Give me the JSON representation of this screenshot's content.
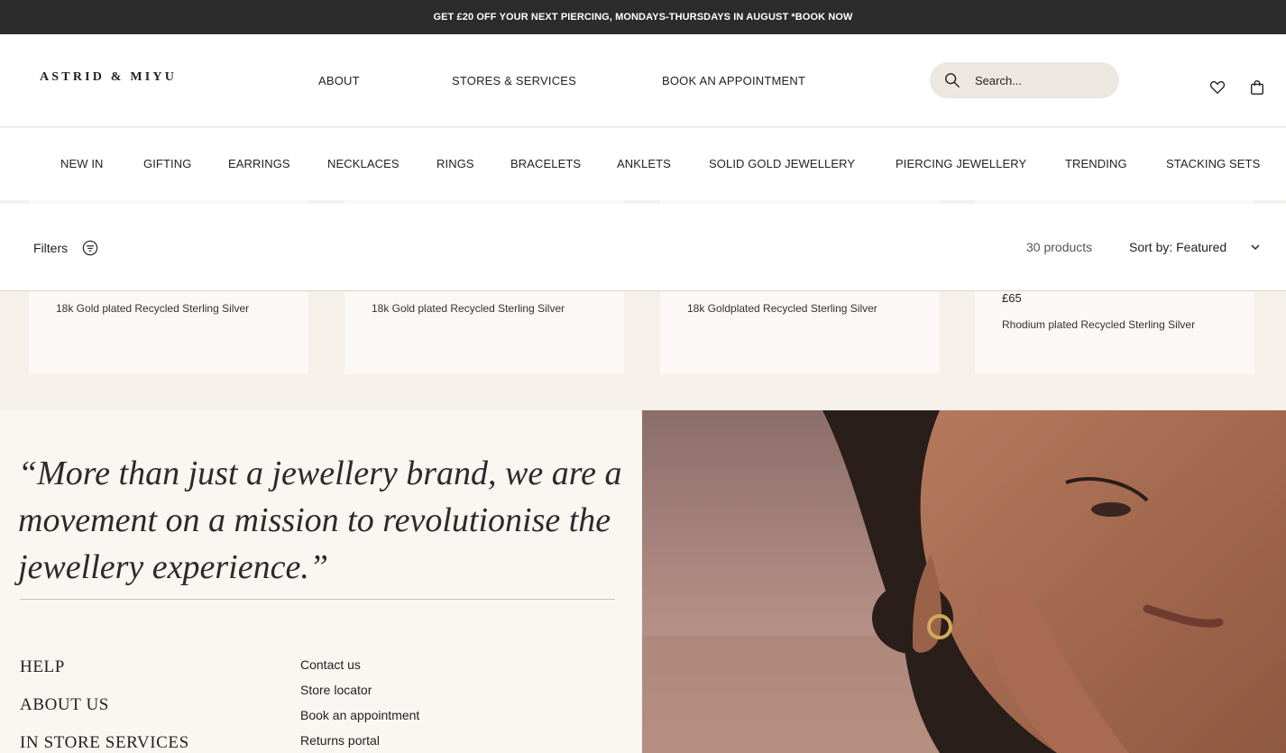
{
  "announcement": {
    "text": "GET £20 OFF YOUR NEXT PIERCING, MONDAYS-THURSDAYS IN AUGUST *BOOK NOW"
  },
  "header": {
    "logo": "ASTRID & MIYU",
    "nav": [
      "ABOUT",
      "STORES & SERVICES",
      "BOOK AN APPOINTMENT"
    ],
    "search_placeholder": "Search...",
    "icons": [
      "search-icon",
      "heart-icon",
      "bag-icon"
    ]
  },
  "categories": [
    "NEW IN",
    "GIFTING",
    "EARRINGS",
    "NECKLACES",
    "RINGS",
    "BRACELETS",
    "ANKLETS",
    "SOLID GOLD JEWELLERY",
    "PIERCING JEWELLERY",
    "TRENDING",
    "STACKING SETS"
  ],
  "filterbar": {
    "filters_label": "Filters",
    "count": "30 products",
    "sort_label": "Sort by: Featured"
  },
  "products": [
    {
      "price": "",
      "material": "18k Gold plated Recycled Sterling Silver"
    },
    {
      "price": "",
      "material": "18k Gold plated Recycled Sterling Silver"
    },
    {
      "price": "",
      "material": "18k Goldplated Recycled Sterling Silver"
    },
    {
      "price": "£65",
      "material": "Rhodium plated Recycled Sterling Silver"
    }
  ],
  "footer": {
    "quote": "“More than just a jewellery brand, we are a movement on a mission to revolutionise the jewellery experience.”",
    "headings": [
      "HELP",
      "ABOUT US",
      "IN STORE SERVICES"
    ],
    "links": [
      "Contact us",
      "Store locator",
      "Book an appointment",
      "Returns portal"
    ]
  },
  "colors": {
    "announcement_bg": "#2c2c2c",
    "page_bg": "#f6f0ea",
    "card_bg": "#fbf8f5",
    "search_bg": "#ece7e1"
  }
}
